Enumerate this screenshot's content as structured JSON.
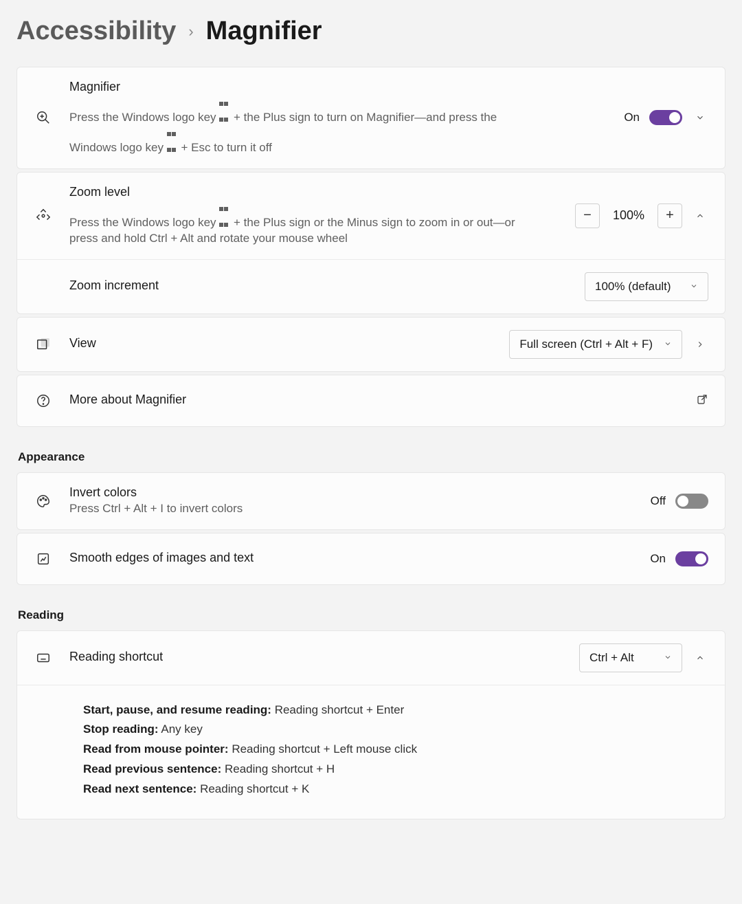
{
  "breadcrumb": {
    "parent": "Accessibility",
    "current": "Magnifier"
  },
  "magnifier": {
    "title": "Magnifier",
    "desc_pre": "Press the Windows logo key ",
    "desc_mid": " + the Plus sign to turn on Magnifier—and press the Windows logo key ",
    "desc_post": " + Esc to turn it off",
    "state": "On"
  },
  "zoom_level": {
    "title": "Zoom level",
    "desc_pre": "Press the Windows logo key ",
    "desc_post": " + the Plus sign or the Minus sign to zoom in or out—or press and hold Ctrl + Alt and rotate your mouse wheel",
    "value": "100%"
  },
  "zoom_increment": {
    "title": "Zoom increment",
    "value": "100% (default)"
  },
  "view": {
    "title": "View",
    "value": "Full screen (Ctrl + Alt + F)"
  },
  "more": {
    "title": "More about Magnifier"
  },
  "appearance_section": "Appearance",
  "invert": {
    "title": "Invert colors",
    "desc": "Press Ctrl + Alt + I to invert colors",
    "state": "Off"
  },
  "smooth": {
    "title": "Smooth edges of images and text",
    "state": "On"
  },
  "reading_section": "Reading",
  "reading_shortcut": {
    "title": "Reading shortcut",
    "value": "Ctrl + Alt"
  },
  "shortcuts": {
    "start_label": "Start, pause, and resume reading:",
    "start_val": "Reading shortcut + Enter",
    "stop_label": "Stop reading:",
    "stop_val": "Any key",
    "mouse_label": "Read from mouse pointer:",
    "mouse_val": "Reading shortcut + Left mouse click",
    "prev_label": "Read previous sentence:",
    "prev_val": "Reading shortcut + H",
    "next_label": "Read next sentence:",
    "next_val": "Reading shortcut + K"
  }
}
